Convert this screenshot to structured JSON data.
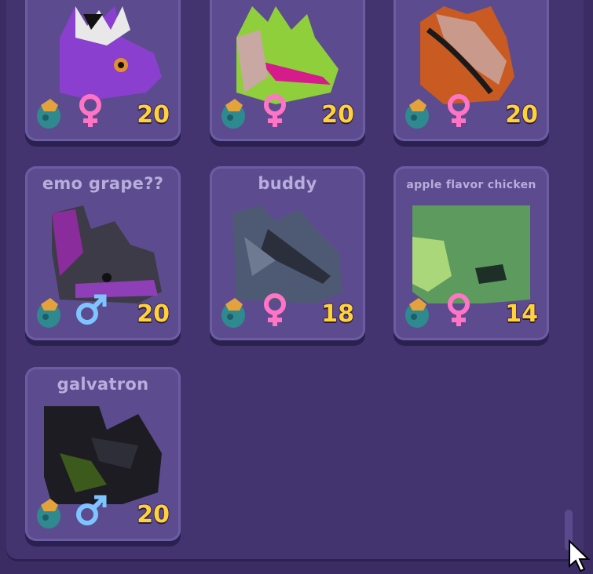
{
  "pets": [
    {
      "name": "",
      "age": "20",
      "gender": "female"
    },
    {
      "name": "",
      "age": "20",
      "gender": "female"
    },
    {
      "name": "",
      "age": "20",
      "gender": "female"
    },
    {
      "name": "emo grape??",
      "age": "20",
      "gender": "male"
    },
    {
      "name": "buddy",
      "age": "18",
      "gender": "female"
    },
    {
      "name": "apple flavor chicken",
      "age": "14",
      "gender": "female"
    },
    {
      "name": "galvatron",
      "age": "20",
      "gender": "male"
    }
  ],
  "colors": {
    "female_symbol": "#ff74c4",
    "male_symbol": "#7ec4ff",
    "age_text": "#ffd23a",
    "card_bg": "#5c4c8f",
    "panel_bg": "#433470"
  },
  "icons": {
    "egg": "dragon-egg-icon",
    "female": "female-symbol-icon",
    "male": "male-symbol-icon"
  }
}
